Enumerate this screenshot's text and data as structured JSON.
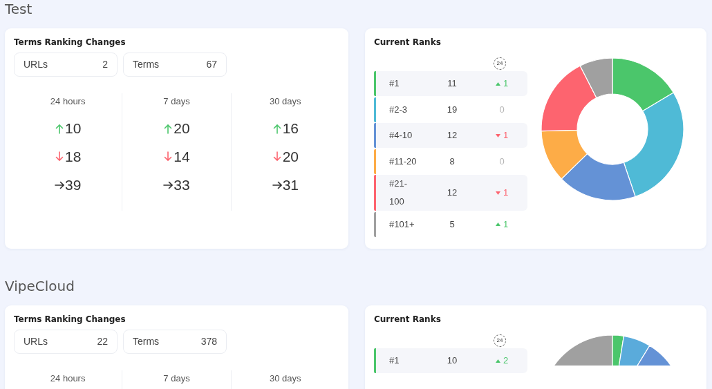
{
  "sections": [
    {
      "title": "Test",
      "changes": {
        "title": "Terms Ranking Changes",
        "stats": [
          {
            "label": "URLs",
            "value": "2"
          },
          {
            "label": "Terms",
            "value": "67"
          }
        ],
        "periods": [
          {
            "label": "24 hours",
            "up": "10",
            "down": "18",
            "same": "39"
          },
          {
            "label": "7 days",
            "up": "20",
            "down": "14",
            "same": "33"
          },
          {
            "label": "30 days",
            "up": "16",
            "down": "20",
            "same": "31"
          }
        ]
      },
      "ranks": {
        "title": "Current Ranks",
        "period": "24",
        "rows": [
          {
            "label": "#1",
            "count": "11",
            "delta": "1",
            "kind": "up",
            "color": "#4bc66b"
          },
          {
            "label": "#2-3",
            "count": "19",
            "delta": "0",
            "kind": "flat",
            "color": "#4fbad6"
          },
          {
            "label": "#4-10",
            "count": "12",
            "delta": "1",
            "kind": "down",
            "color": "#6492d6"
          },
          {
            "label": "#11-20",
            "count": "8",
            "delta": "0",
            "kind": "flat",
            "color": "#fdac47"
          },
          {
            "label": "#21-100",
            "count": "12",
            "delta": "1",
            "kind": "down",
            "color": "#fd646f"
          },
          {
            "label": "#101+",
            "count": "5",
            "delta": "1",
            "kind": "up",
            "color": "#a0a0a0"
          }
        ],
        "chart_data": {
          "type": "donut",
          "series": [
            {
              "values": [
                16.4,
                28.4,
                17.9,
                11.9,
                17.9,
                7.5
              ]
            }
          ]
        }
      }
    },
    {
      "title": "VipeCloud",
      "changes": {
        "title": "Terms Ranking Changes",
        "stats": [
          {
            "label": "URLs",
            "value": "22"
          },
          {
            "label": "Terms",
            "value": "378"
          }
        ],
        "periods": [
          {
            "label": "24 hours"
          },
          {
            "label": "7 days"
          },
          {
            "label": "30 days"
          }
        ]
      },
      "ranks": {
        "title": "Current Ranks",
        "period": "24",
        "rows": [
          {
            "label": "#1",
            "count": "10",
            "delta": "2",
            "kind": "up",
            "color": "#4bc66b"
          }
        ]
      }
    }
  ]
}
